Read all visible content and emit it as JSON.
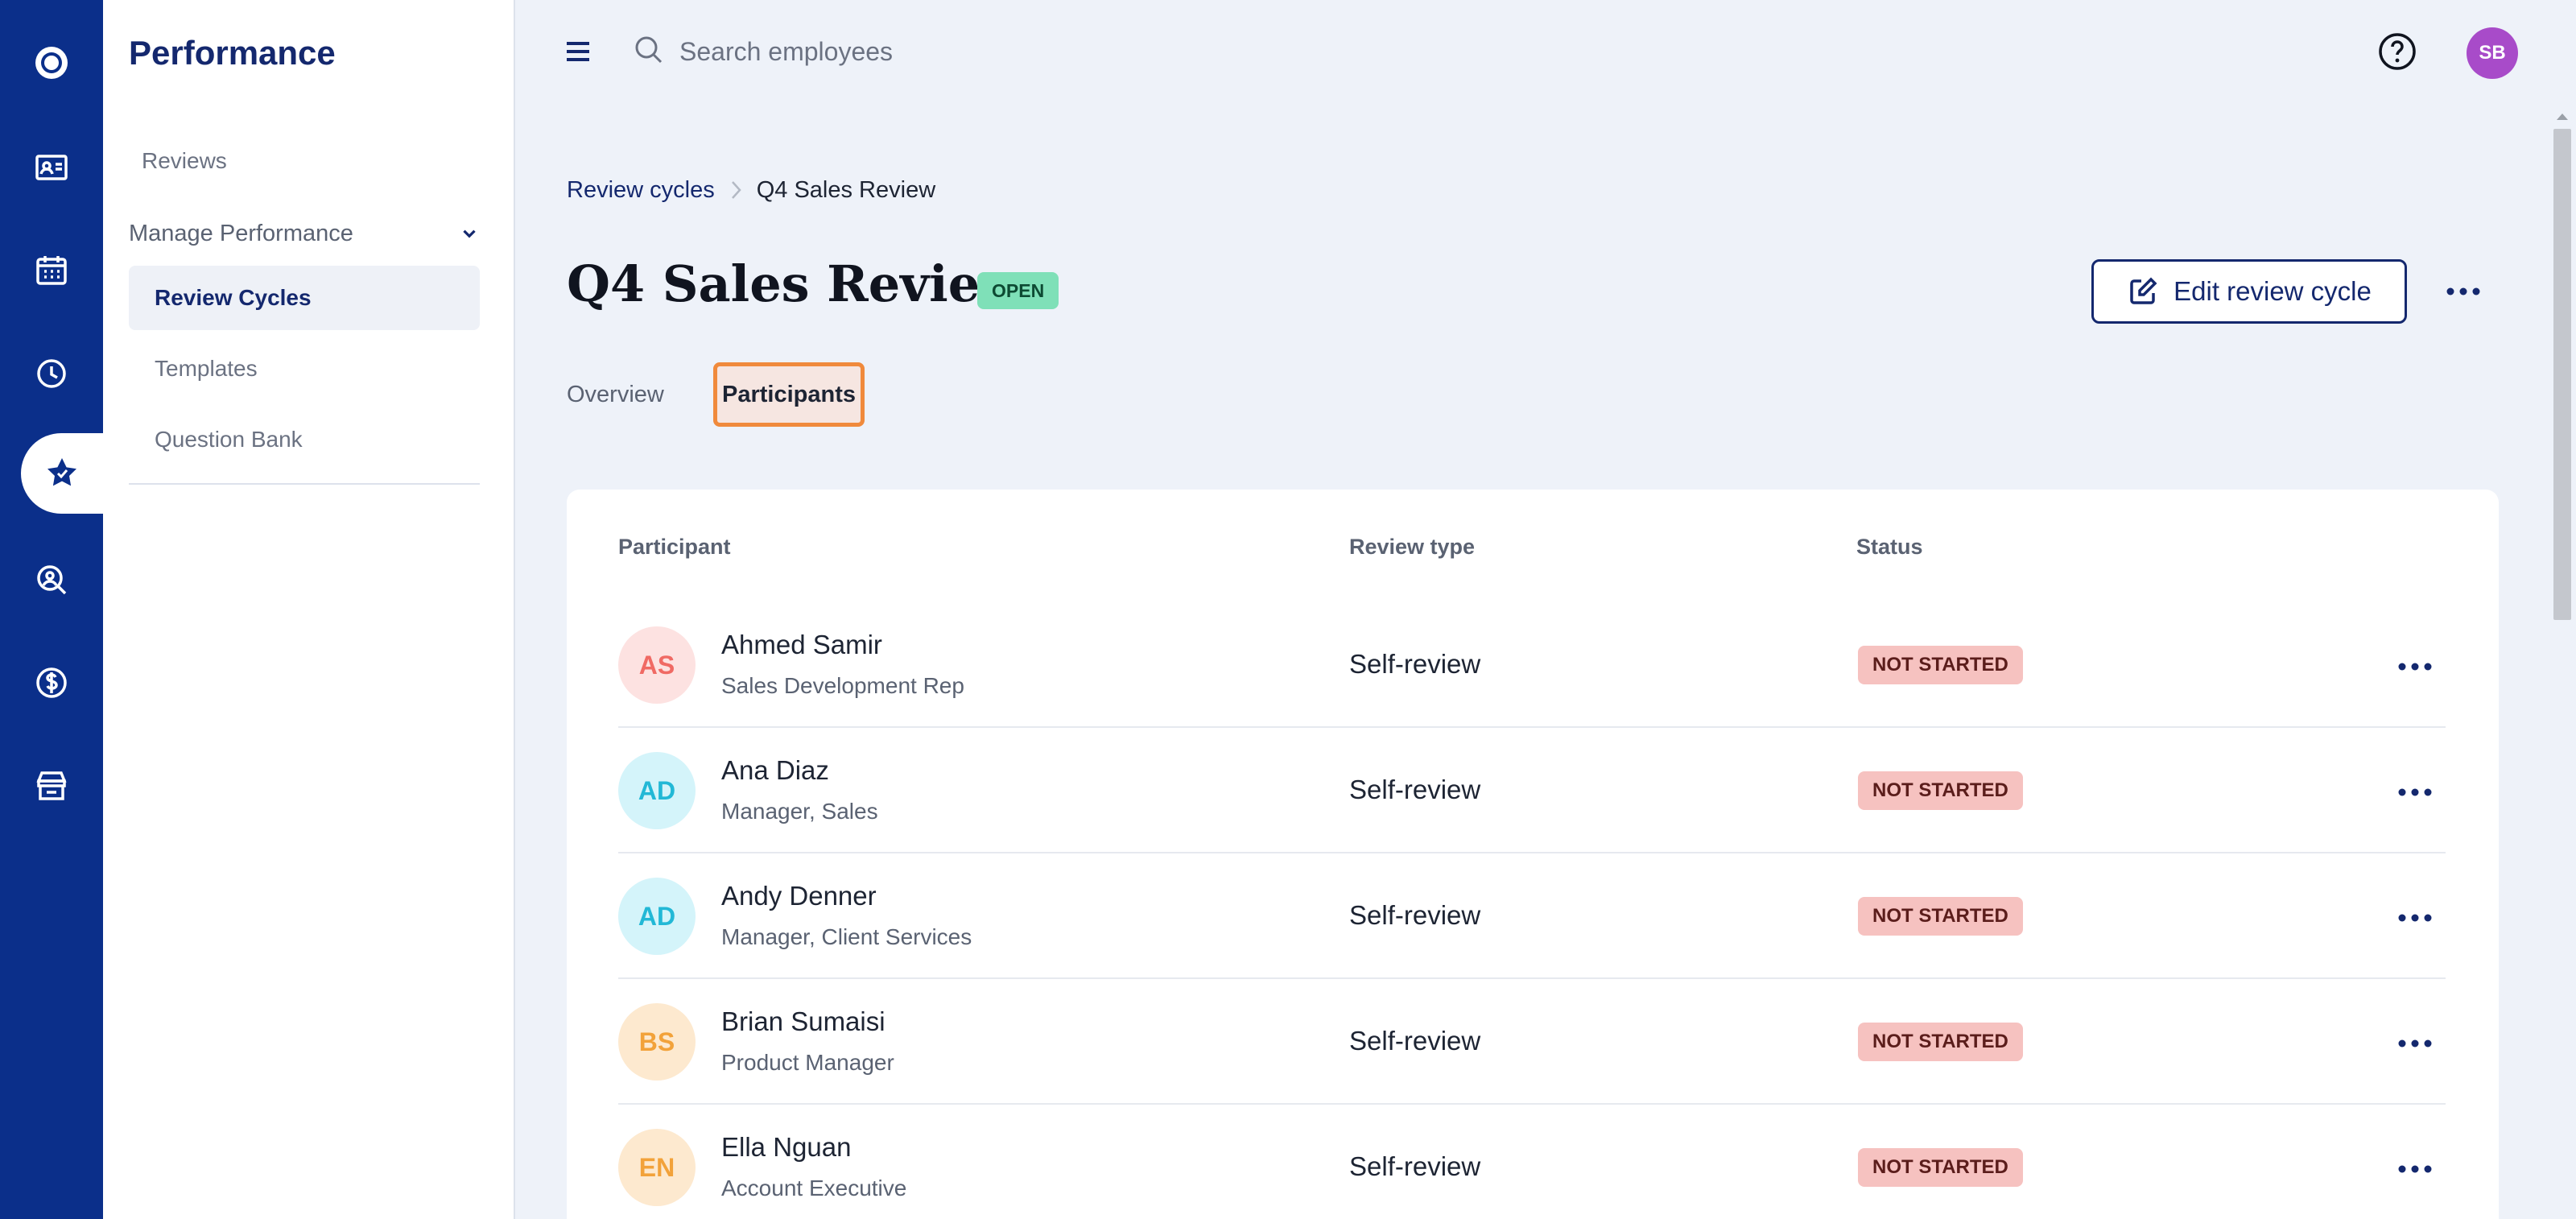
{
  "nav_rail": {
    "items": [
      {
        "icon": "logo-icon"
      },
      {
        "icon": "contact-card-icon"
      },
      {
        "icon": "calendar-icon"
      },
      {
        "icon": "clock-icon"
      },
      {
        "icon": "star-badge-icon",
        "active": true
      },
      {
        "icon": "person-search-icon"
      },
      {
        "icon": "dollar-circle-icon"
      },
      {
        "icon": "storefront-icon"
      }
    ]
  },
  "sidebar": {
    "title": "Performance",
    "reviews_label": "Reviews",
    "group_label": "Manage Performance",
    "items": [
      {
        "label": "Review Cycles",
        "active": true
      },
      {
        "label": "Templates"
      },
      {
        "label": "Question Bank"
      }
    ]
  },
  "topbar": {
    "search_placeholder": "Search employees",
    "avatar_initials": "SB"
  },
  "breadcrumb": {
    "parent": "Review cycles",
    "current": "Q4 Sales Review"
  },
  "header": {
    "title": "Q4 Sales Review",
    "status": "OPEN",
    "edit_label": "Edit review cycle"
  },
  "tabs": [
    {
      "label": "Overview"
    },
    {
      "label": "Participants",
      "active": true
    }
  ],
  "table": {
    "columns": [
      "Participant",
      "Review type",
      "Status"
    ],
    "rows": [
      {
        "initials": "AS",
        "name": "Ahmed Samir",
        "role": "Sales Development Rep",
        "review_type": "Self-review",
        "status": "NOT STARTED"
      },
      {
        "initials": "AD",
        "name": "Ana Diaz",
        "role": "Manager, Sales",
        "review_type": "Self-review",
        "status": "NOT STARTED"
      },
      {
        "initials": "AD",
        "name": "Andy Denner",
        "role": "Manager, Client Services",
        "review_type": "Self-review",
        "status": "NOT STARTED"
      },
      {
        "initials": "BS",
        "name": "Brian Sumaisi",
        "role": "Product Manager",
        "review_type": "Self-review",
        "status": "NOT STARTED"
      },
      {
        "initials": "EN",
        "name": "Ella Nguan",
        "role": "Account Executive",
        "review_type": "Self-review",
        "status": "NOT STARTED"
      }
    ]
  },
  "colors": {
    "rail_bg": "#0b2f8a",
    "brand_text": "#14286e",
    "open_badge": "#7fe0b8",
    "not_started_badge": "#f6c2c0",
    "tab_focus_outline": "#f08a3c",
    "avatar_top": "#a84bc9"
  }
}
